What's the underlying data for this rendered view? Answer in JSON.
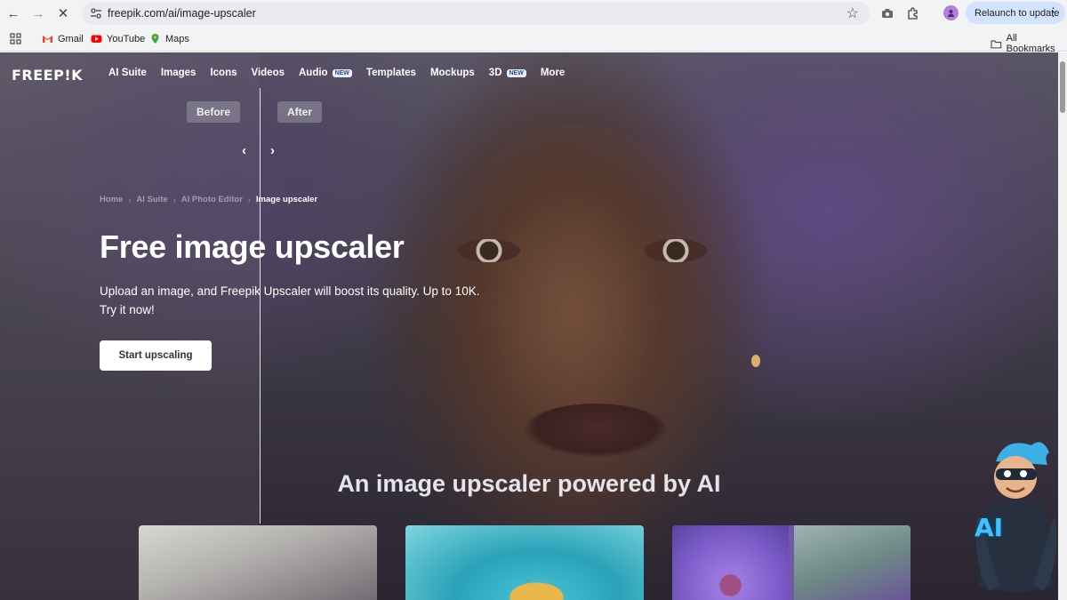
{
  "browser": {
    "url": "freepik.com/ai/image-upscaler",
    "relaunch_label": "Relaunch to update",
    "bookmarks": [
      {
        "label": "Gmail",
        "icon": "gmail-icon"
      },
      {
        "label": "YouTube",
        "icon": "youtube-icon"
      },
      {
        "label": "Maps",
        "icon": "maps-icon"
      }
    ],
    "all_bookmarks_label": "All Bookmarks"
  },
  "site": {
    "logo": "FREEP!K",
    "nav": [
      {
        "label": "AI Suite",
        "badge": ""
      },
      {
        "label": "Images",
        "badge": ""
      },
      {
        "label": "Icons",
        "badge": ""
      },
      {
        "label": "Videos",
        "badge": ""
      },
      {
        "label": "Audio",
        "badge": "NEW"
      },
      {
        "label": "Templates",
        "badge": ""
      },
      {
        "label": "Mockups",
        "badge": ""
      },
      {
        "label": "3D",
        "badge": "NEW"
      },
      {
        "label": "More",
        "badge": ""
      }
    ]
  },
  "compare": {
    "before_label": "Before",
    "after_label": "After",
    "prev_arrow": "‹",
    "next_arrow": "›",
    "slider_position": 0.245
  },
  "breadcrumb": {
    "items": [
      "Home",
      "AI Suite",
      "AI Photo Editor"
    ],
    "current": "Image upscaler"
  },
  "hero": {
    "title": "Free image upscaler",
    "subtitle": "Upload an image, and Freepik Upscaler will boost its quality. Up to 10K. Try it now!",
    "cta_label": "Start upscaling"
  },
  "section": {
    "title": "An image upscaler powered by AI"
  },
  "mascot": {
    "label": "AI"
  },
  "colors": {
    "chrome_bg": "#f1f3f4",
    "relaunch_bg": "#d3e3fd",
    "badge_bg": "#e8f0ff"
  }
}
